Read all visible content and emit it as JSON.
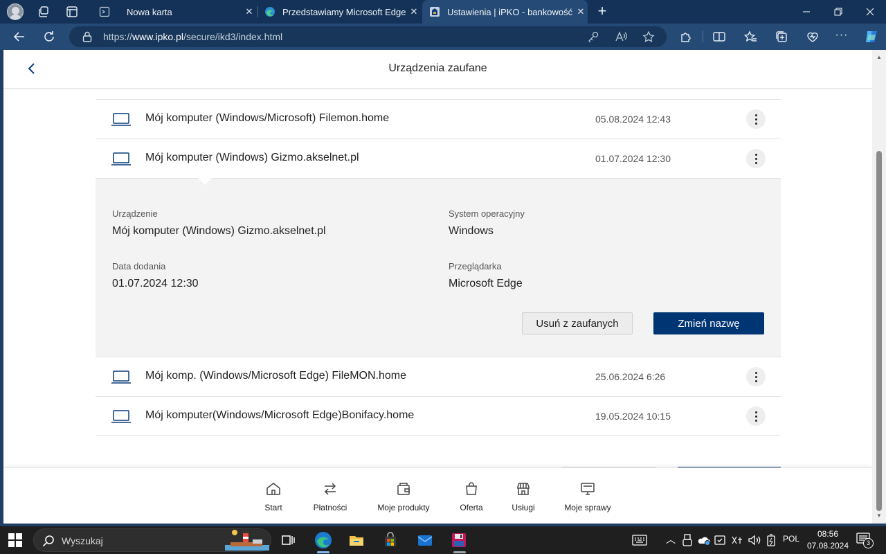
{
  "browser": {
    "tabs": [
      {
        "title": "Nowa karta",
        "active": false
      },
      {
        "title": "Przedstawiamy Microsoft Edge",
        "active": false
      },
      {
        "title": "Ustawienia | iPKO - bankowość el",
        "active": true
      }
    ],
    "url_prefix": "https://",
    "url_domain": "www.ipko.pl",
    "url_path": "/secure/ikd3/index.html"
  },
  "page": {
    "title": "Urządzenia zaufane",
    "devices_before": [
      {
        "name": "Mój komputer (Windows/Microsoft) Filemon.home",
        "date": "05.08.2024 12:43"
      },
      {
        "name": "Mój komputer (Windows) Gizmo.akselnet.pl",
        "date": "01.07.2024 12:30"
      }
    ],
    "detail": {
      "device_label": "Urządzenie",
      "device_value": "Mój komputer (Windows) Gizmo.akselnet.pl",
      "os_label": "System operacyjny",
      "os_value": "Windows",
      "date_label": "Data dodania",
      "date_value": "01.07.2024 12:30",
      "browser_label": "Przeglądarka",
      "browser_value": "Microsoft Edge",
      "remove_button": "Usuń z zaufanych",
      "rename_button": "Zmień nazwę"
    },
    "devices_after": [
      {
        "name": "Mój komp. (Windows/Microsoft Edge) FileMON.home",
        "date": "25.06.2024 6:26"
      },
      {
        "name": "Mój komputer(Windows/Microsoft Edge)Bonifacy.home",
        "date": "19.05.2024 10:15"
      }
    ]
  },
  "bottom_nav": [
    "Start",
    "Płatności",
    "Moje produkty",
    "Oferta",
    "Usługi",
    "Moje sprawy"
  ],
  "taskbar": {
    "search_placeholder": "Wyszukaj",
    "language": "POL",
    "time": "08:56",
    "date": "07.08.2024",
    "notifications": "3"
  }
}
